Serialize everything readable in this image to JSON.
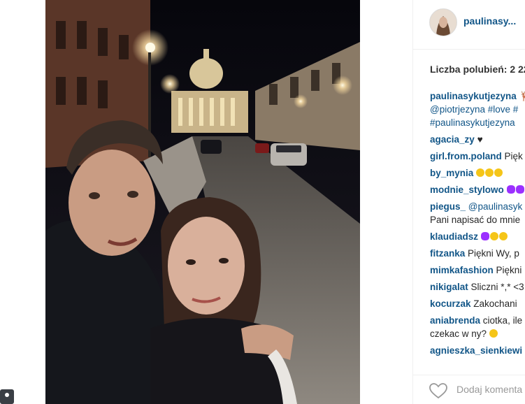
{
  "post": {
    "username": "paulinasy...",
    "likes_label": "Liczba polubień: 2 22",
    "add_comment_placeholder": "Dodaj komenta"
  },
  "caption": {
    "user": "paulinasykutjezyna",
    "text_line2": "@piotrjezyna #love #",
    "text_line3": "#paulinasykutjezyna"
  },
  "comments": [
    {
      "user": "agacia_zy",
      "text": "♥"
    },
    {
      "user": "girl.from.poland",
      "text": "Pięk"
    },
    {
      "user": "by_mynia",
      "text": ""
    },
    {
      "user": "modnie_stylowo",
      "text": ""
    },
    {
      "user": "piegus_",
      "text": "@paulinasyk",
      "text2": "Pani napisać do mnie"
    },
    {
      "user": "klaudiadsz",
      "text": ""
    },
    {
      "user": "fitzanka",
      "text": "Piękni Wy, p"
    },
    {
      "user": "mimkafashion",
      "text": "Piękni"
    },
    {
      "user": "nikigalat",
      "text": "Sliczni *,* <3"
    },
    {
      "user": "kocurzak",
      "text": "Zakochani"
    },
    {
      "user": "aniabrenda",
      "text": "ciotka, ile",
      "text2": "czekac w ny?"
    },
    {
      "user": "agnieszka_sienkiewi",
      "text": ""
    }
  ]
}
